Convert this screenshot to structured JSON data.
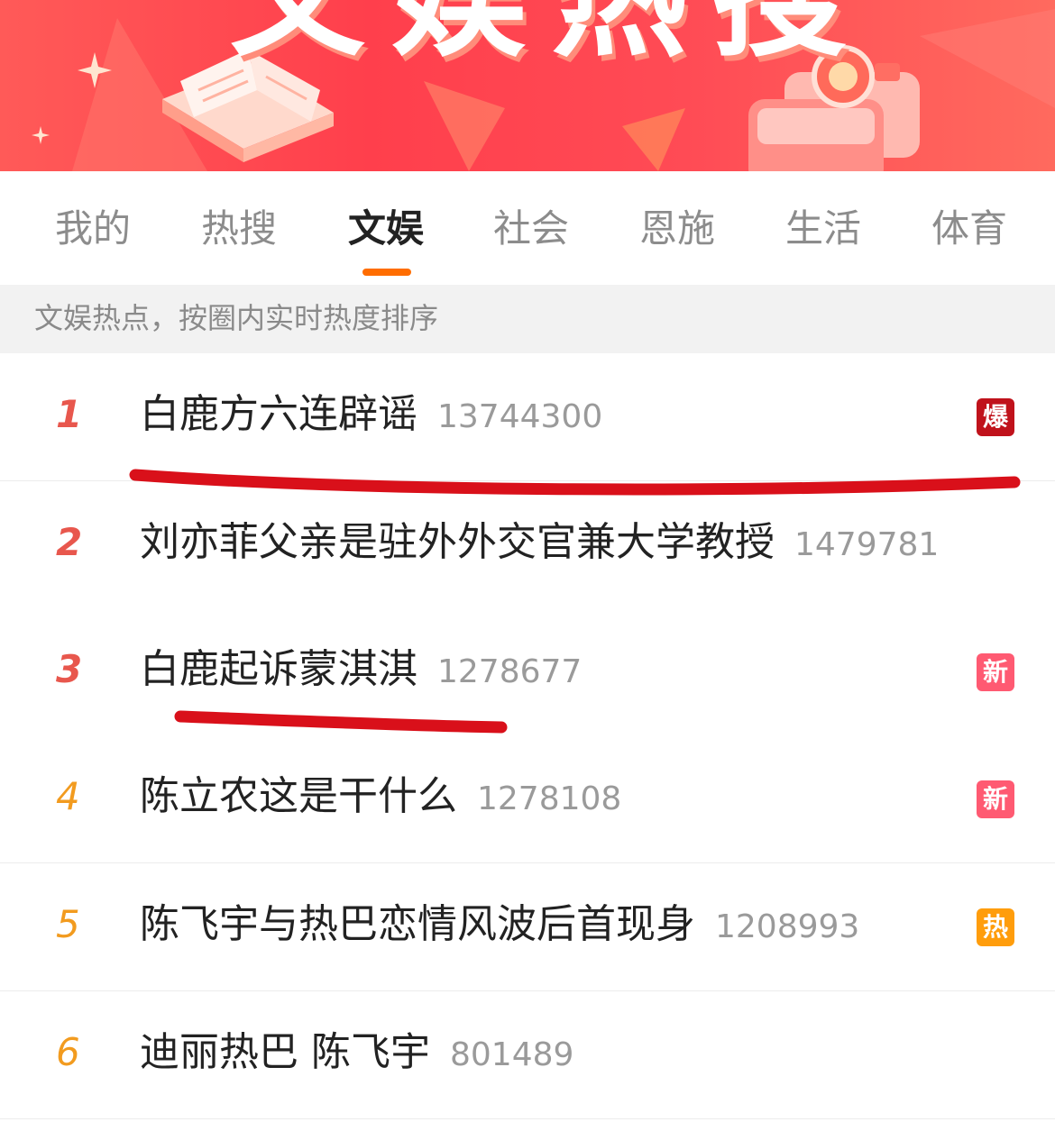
{
  "banner": {
    "title": "文娱热搜",
    "background_color": "#ff4b55"
  },
  "tabs": [
    {
      "label": "我的",
      "active": false
    },
    {
      "label": "热搜",
      "active": false
    },
    {
      "label": "文娱",
      "active": true
    },
    {
      "label": "社会",
      "active": false
    },
    {
      "label": "恩施",
      "active": false
    },
    {
      "label": "生活",
      "active": false
    },
    {
      "label": "体育",
      "active": false
    }
  ],
  "tab_indicator_color": "#ff6d00",
  "subtitle": "文娱热点，按圈内实时热度排序",
  "list": [
    {
      "rank": "1",
      "title": "白鹿方六连辟谣",
      "count": "13744300",
      "badge": "爆"
    },
    {
      "rank": "2",
      "title": "刘亦菲父亲是驻外外交官兼大学教授",
      "count": "1479781",
      "badge": ""
    },
    {
      "rank": "3",
      "title": "白鹿起诉蒙淇淇",
      "count": "1278677",
      "badge": "新"
    },
    {
      "rank": "4",
      "title": "陈立农这是干什么",
      "count": "1278108",
      "badge": "新"
    },
    {
      "rank": "5",
      "title": "陈飞宇与热巴恋情风波后首现身",
      "count": "1208993",
      "badge": "热"
    },
    {
      "rank": "6",
      "title": "迪丽热巴 陈飞宇",
      "count": "801489",
      "badge": ""
    }
  ],
  "colors": {
    "rank_top": "#e8574d",
    "rank_other": "#f29b1f",
    "badge_bao": "#c0121b",
    "badge_xin": "#ff5a72",
    "badge_re": "#ff9d0c",
    "annotation_red": "#d9101a"
  }
}
